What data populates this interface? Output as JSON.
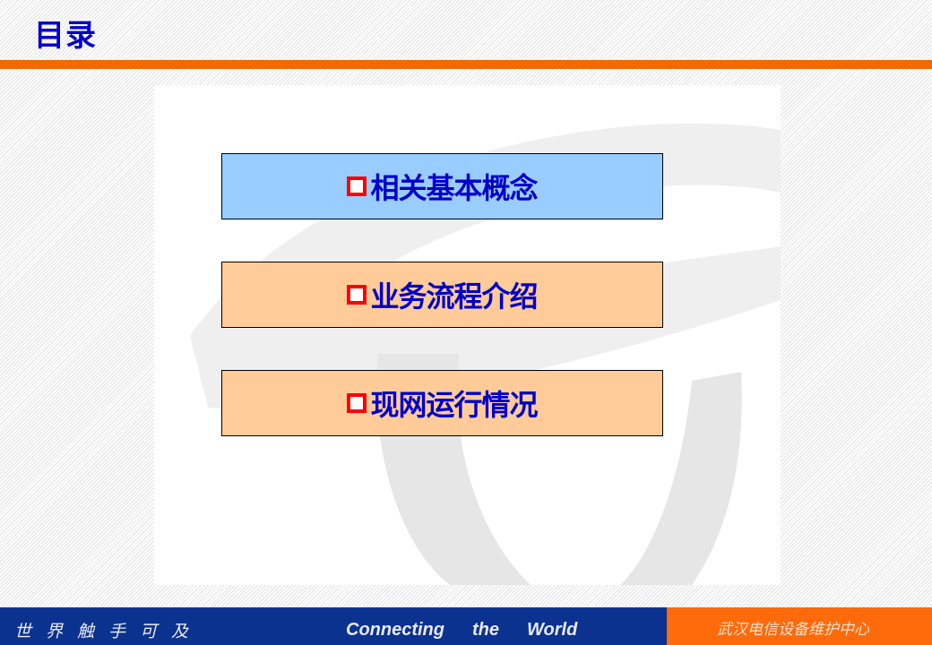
{
  "header": {
    "title": "目录"
  },
  "menu": {
    "items": [
      {
        "label": "相关基本概念",
        "bullet_icon": "hollow-square"
      },
      {
        "label": "业务流程介绍",
        "bullet_icon": "hollow-square"
      },
      {
        "label": "现网运行情况",
        "bullet_icon": "hollow-square"
      }
    ]
  },
  "footer": {
    "slogan_cn": "世界触手可及",
    "slogan_en": [
      "Connecting",
      "the",
      "World"
    ],
    "organization": "武汉电信设备维护中心"
  },
  "colors": {
    "title": "#0000c8",
    "accent_orange": "#f06a00",
    "bullet": "#ff0000",
    "box_active": "#99ccff",
    "box_default": "#ffcc99",
    "footer_blue": "#0c3290",
    "footer_orange": "#ff6a0a"
  }
}
